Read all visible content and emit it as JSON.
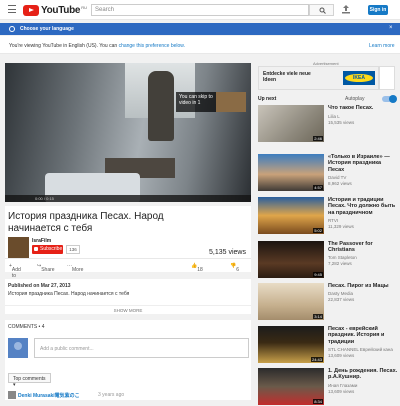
{
  "header": {
    "logo_text": "YouTube",
    "logo_region": "RU",
    "search_placeholder": "Search",
    "signin_label": "Sign in"
  },
  "language_bar": {
    "title": "Choose your language",
    "note_prefix": "You're viewing YouTube in English (US). You can ",
    "note_link": "change this preference below.",
    "learn_more": "Learn more",
    "close": "×"
  },
  "player": {
    "skip_note": "You can skip to video in 1",
    "time": "0:00 / 0:15",
    "colors": {
      "accent": "#e62117",
      "link": "#167ac6"
    }
  },
  "video": {
    "title": "История праздника Песах. Народ начинается с тебя",
    "channel": "IsraFilm",
    "subscribe_label": "Subscribe",
    "subscriber_count": "136",
    "views": "5,135 views",
    "actions": {
      "add": "Add to",
      "share": "Share",
      "more": "More",
      "likes": "18",
      "dislikes": "6"
    }
  },
  "description": {
    "published": "Published on Mar 27, 2013",
    "text": "История праздника Песах. Народ начинается с тебя",
    "show_more": "SHOW MORE"
  },
  "comments": {
    "count_label": "COMMENTS • 4",
    "placeholder": "Add a public comment...",
    "sort_label": "Top comments ▾",
    "first_author": "Denki Murasaki電気紫のこ",
    "first_time": "3 years ago"
  },
  "sidebar": {
    "ad_label": "Advertisement",
    "ad_text": "Entdecke viele neue Ideen",
    "ad_brand": "IKEA",
    "up_next": "Up next",
    "autoplay": "Autoplay",
    "items": [
      {
        "title": "Что такое Песах.",
        "channel": "Lilia L",
        "views": "15,535 views",
        "duration": "2:46"
      },
      {
        "title": "«Только в Израиле» — История праздника Песах",
        "channel": "David TV",
        "views": "8,962 views",
        "duration": "4:57"
      },
      {
        "title": "История и традиции Песах. Что должно быть на праздничном",
        "channel": "RTVI",
        "views": "11,329 views",
        "duration": "5:02"
      },
      {
        "title": "The Passover for Christians",
        "channel": "Tom Stapleton",
        "views": "7,282 views",
        "duration": "9:45"
      },
      {
        "title": "Песах. Пирог из Мацы",
        "channel": "Dasty Media",
        "views": "22,837 views",
        "duration": "3:14"
      },
      {
        "title": "Песах - еврейский праздник. История и традиции",
        "channel": "STL CHANNEL Еврейский кана",
        "views": "13,609 views",
        "duration": "24:43"
      },
      {
        "title": "1. День рождения. Песах. р.А.Кушнир.",
        "channel": "Иная Глазами",
        "views": "13,609 views",
        "duration": "8:34"
      }
    ]
  }
}
